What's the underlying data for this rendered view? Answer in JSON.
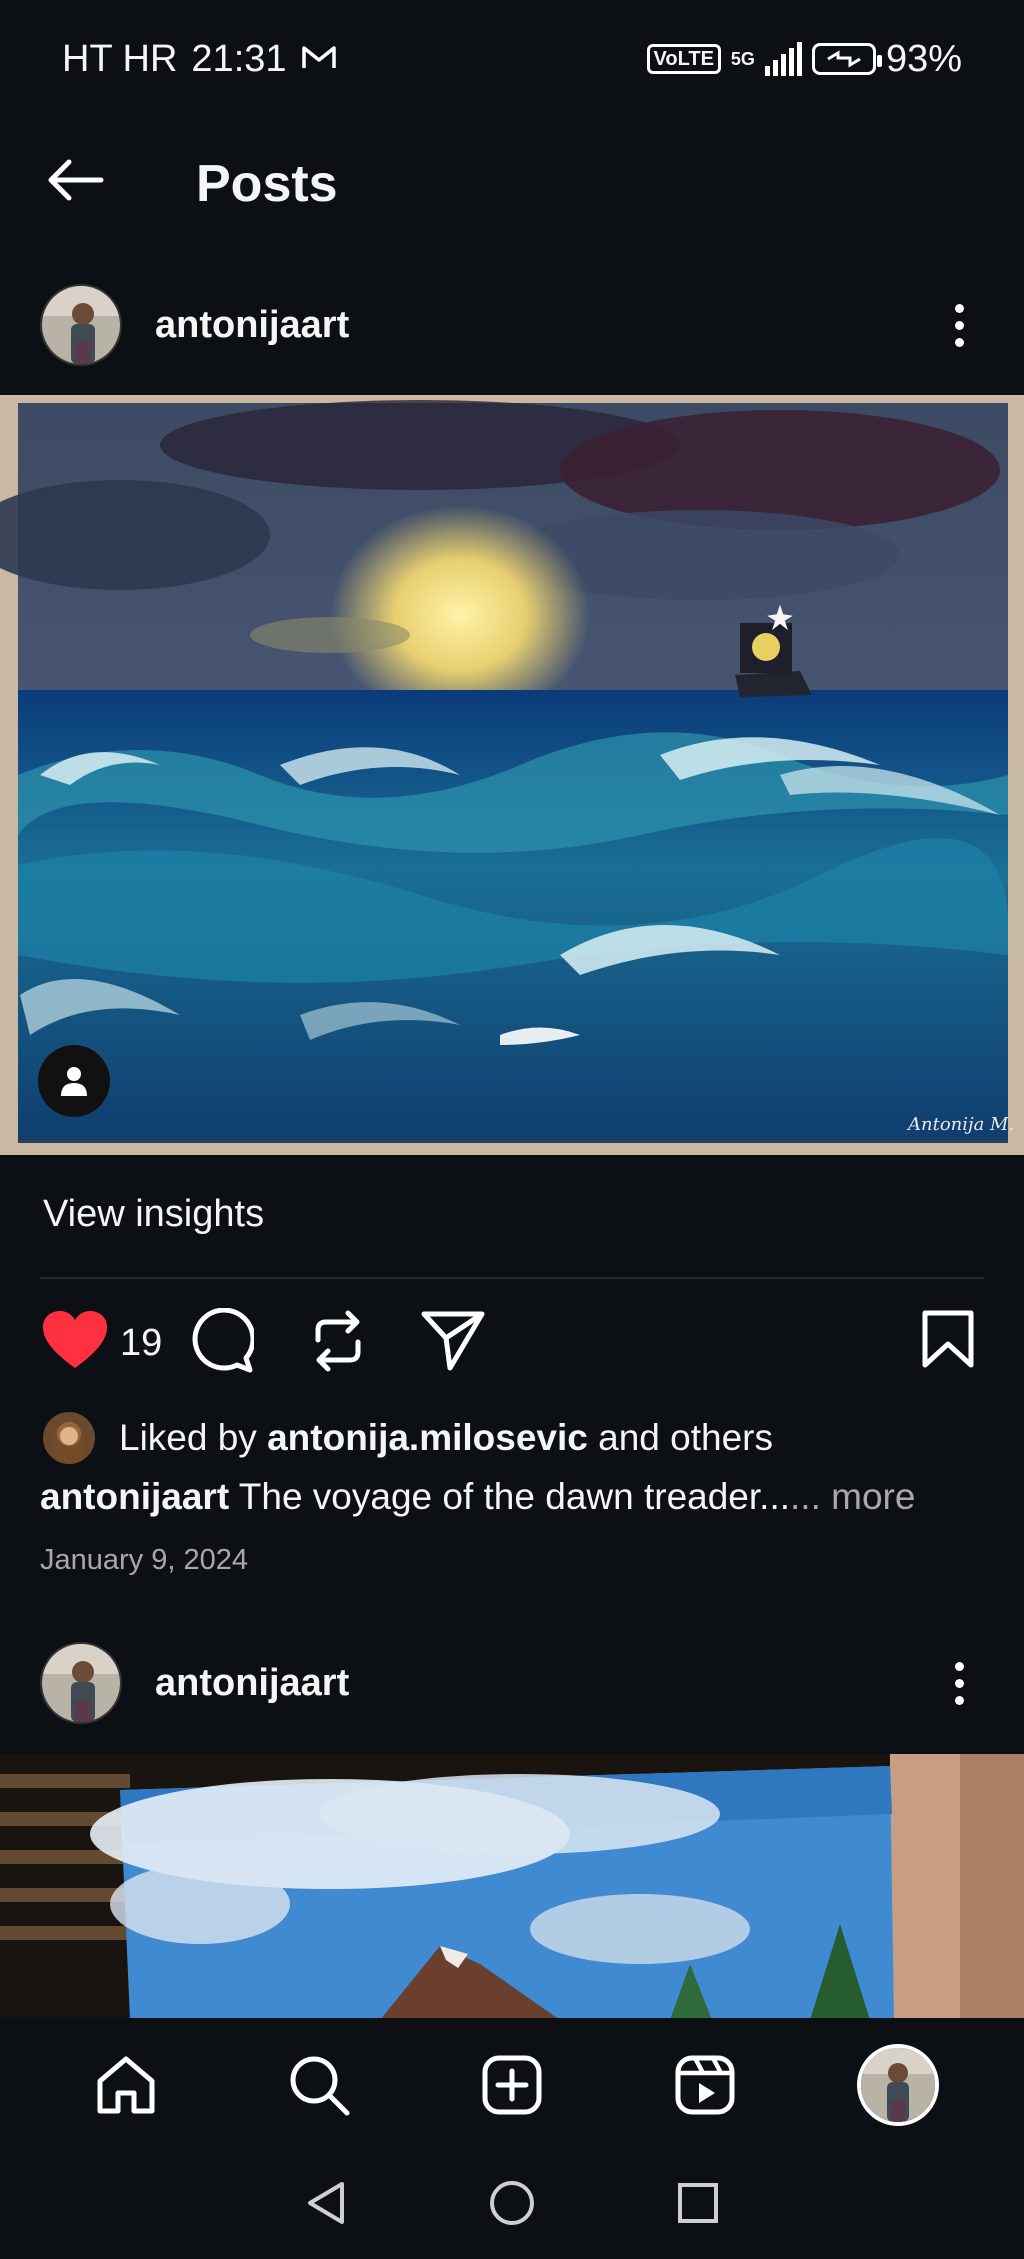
{
  "status_bar": {
    "carrier": "HT HR",
    "time": "21:31",
    "network_badge": "VoLTE",
    "network_type": "5G",
    "battery": "93%",
    "icons": [
      "gmail-icon",
      "signal-icon",
      "battery-icon"
    ]
  },
  "header": {
    "title": "Posts",
    "back_icon": "arrow-left-icon"
  },
  "posts": [
    {
      "username": "antonijaart",
      "image_signature": "Antonija M.",
      "insights_label": "View insights",
      "like_count": "19",
      "liked_by_prefix": "Liked by",
      "liked_by_user": "antonija.milosevic",
      "liked_by_suffix": "and others",
      "caption_user": "antonijaart",
      "caption_text": "The voyage of the dawn treader.",
      "caption_ellipsis": "..",
      "caption_more": "... more",
      "date": "January 9, 2024"
    },
    {
      "username": "antonijaart"
    }
  ],
  "bottom_nav": {
    "items": [
      "home-icon",
      "search-icon",
      "create-icon",
      "reels-icon",
      "profile-avatar"
    ]
  },
  "system_nav": [
    "back-triangle-icon",
    "home-circle-icon",
    "recents-square-icon"
  ],
  "colors": {
    "background": "#0c1014",
    "heart": "#ff3040",
    "secondary_text": "#a8a8a8"
  }
}
